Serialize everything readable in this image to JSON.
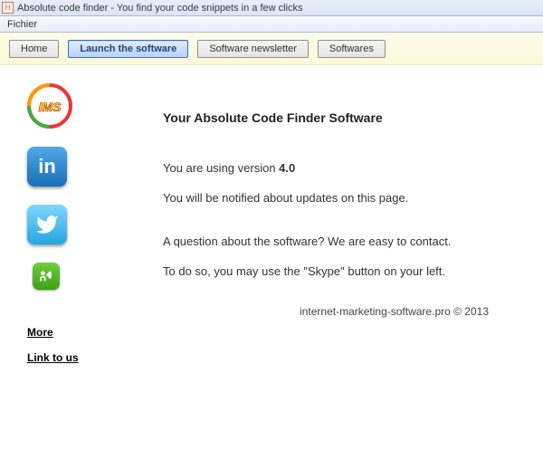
{
  "window": {
    "title": "Absolute code finder - You find your code snippets in a few clicks"
  },
  "menubar": {
    "fichier": "Fichier"
  },
  "toolbar": {
    "home": "Home",
    "launch": "Launch the software",
    "newsletter": "Software newsletter",
    "softwares": "Softwares"
  },
  "sidebar": {
    "more": "More",
    "link_to_us": "Link to us"
  },
  "main": {
    "heading": "Your Absolute Code Finder Software",
    "line1_a": "You are using version ",
    "line1_b": "4.0",
    "line2": "You will be notified about updates on this page.",
    "line3": "A question about the software? We are easy to contact.",
    "line4": "To do so, you may use the \"Skype\" button on your left."
  },
  "footer": {
    "text": "internet-marketing-software.pro © 2013"
  }
}
